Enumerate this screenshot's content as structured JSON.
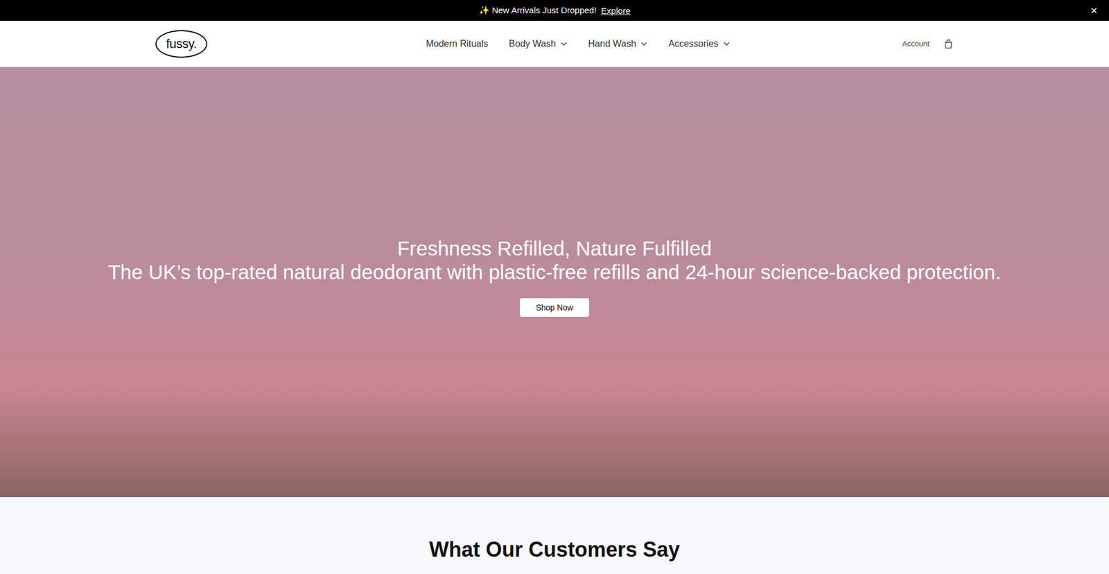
{
  "announcement": {
    "text": "✨ New Arrivals Just Dropped!",
    "link": "Explore",
    "close": "×"
  },
  "header": {
    "logo": "fussy.",
    "nav": [
      {
        "label": "Modern Rituals",
        "dropdown": false
      },
      {
        "label": "Body Wash",
        "dropdown": true
      },
      {
        "label": "Hand Wash",
        "dropdown": true
      },
      {
        "label": "Accessories",
        "dropdown": true
      }
    ],
    "account": "Account"
  },
  "hero": {
    "title": "Freshness Refilled, Nature Fulfilled",
    "subtitle": "The UK’s top-rated natural deodorant with plastic-free refills and 24-hour science-backed protection.",
    "button": "Shop Now"
  },
  "reviews": {
    "title": "What Our Customers Say"
  }
}
